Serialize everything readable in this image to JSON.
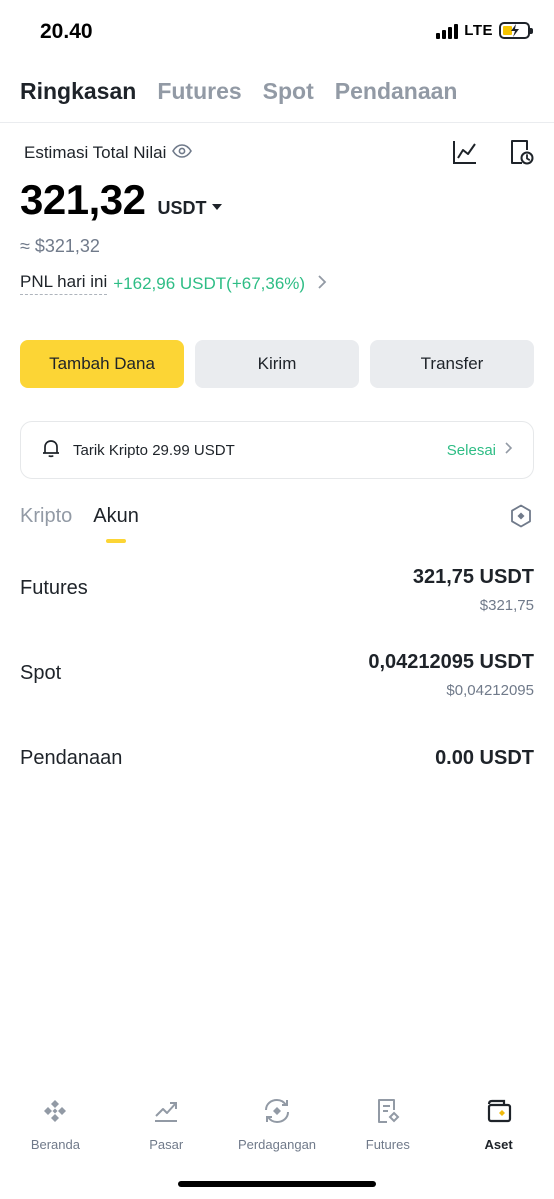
{
  "status_bar": {
    "time": "20.40",
    "network": "LTE"
  },
  "top_tabs": [
    {
      "label": "Ringkasan",
      "active": true
    },
    {
      "label": "Futures",
      "active": false
    },
    {
      "label": "Spot",
      "active": false
    },
    {
      "label": "Pendanaan",
      "active": false
    }
  ],
  "summary": {
    "estimate_label": "Estimasi Total Nilai",
    "total_value": "321,32",
    "currency": "USDT",
    "approx_value": "≈ $321,32",
    "pnl_label": "PNL hari ini",
    "pnl_value": "+162,96 USDT(+67,36%)"
  },
  "actions": {
    "add_funds": "Tambah Dana",
    "send": "Kirim",
    "transfer": "Transfer"
  },
  "notice": {
    "text": "Tarik Kripto 29.99 USDT",
    "status": "Selesai"
  },
  "sub_tabs": [
    {
      "label": "Kripto",
      "active": false
    },
    {
      "label": "Akun",
      "active": true
    }
  ],
  "accounts": [
    {
      "name": "Futures",
      "amount": "321,75 USDT",
      "usd": "$321,75"
    },
    {
      "name": "Spot",
      "amount": "0,04212095 USDT",
      "usd": "$0,04212095"
    },
    {
      "name": "Pendanaan",
      "amount": "0.00 USDT",
      "usd": ""
    }
  ],
  "bottom_nav": [
    {
      "label": "Beranda",
      "icon": "binance-logo-icon"
    },
    {
      "label": "Pasar",
      "icon": "market-chart-icon"
    },
    {
      "label": "Perdagangan",
      "icon": "trade-exchange-icon"
    },
    {
      "label": "Futures",
      "icon": "futures-doc-icon"
    },
    {
      "label": "Aset",
      "icon": "wallet-icon",
      "active": true
    }
  ],
  "colors": {
    "accent": "#fcd535",
    "positive": "#2ebd85",
    "muted": "#707a8a",
    "text": "#1e2329"
  }
}
